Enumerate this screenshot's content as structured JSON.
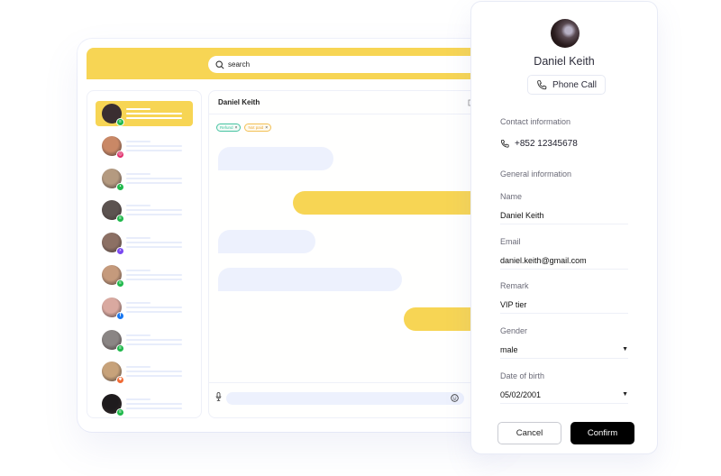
{
  "search": {
    "placeholder": "search",
    "icon": "search-icon"
  },
  "contacts": [
    {
      "avatar_color": "#3a2e31",
      "channel": "line",
      "badge_color": "#20b94c",
      "active": true
    },
    {
      "avatar_color": "#c98866",
      "channel": "instagram",
      "badge_color": "#e1306c",
      "active": false
    },
    {
      "avatar_color": "#b49a80",
      "channel": "wechat",
      "badge_color": "#20b94c",
      "active": false
    },
    {
      "avatar_color": "#5c5350",
      "channel": "line",
      "badge_color": "#20b94c",
      "active": false
    },
    {
      "avatar_color": "#8c7064",
      "channel": "messenger",
      "badge_color": "#7a48f0",
      "active": false
    },
    {
      "avatar_color": "#c59a7c",
      "channel": "line",
      "badge_color": "#20b94c",
      "active": false
    },
    {
      "avatar_color": "#d9a9a0",
      "channel": "facebook",
      "badge_color": "#1877f2",
      "active": false
    },
    {
      "avatar_color": "#8a8584",
      "channel": "line",
      "badge_color": "#20b94c",
      "active": false
    },
    {
      "avatar_color": "#c7a27a",
      "channel": "other",
      "badge_color": "#f06a35",
      "active": false
    },
    {
      "avatar_color": "#1e1b1d",
      "channel": "line",
      "badge_color": "#20b94c",
      "active": false
    }
  ],
  "chat": {
    "title": "Daniel Keith",
    "tags": [
      {
        "label": "Refund",
        "color": "green"
      },
      {
        "label": "Not paid",
        "color": "orange"
      }
    ],
    "remove_tag_glyph": "×"
  },
  "profile": {
    "name": "Daniel Keith",
    "phone_call_label": "Phone Call",
    "contact_section": "Contact information",
    "phone": "+852 12345678",
    "general_section": "General information",
    "fields": {
      "name": {
        "label": "Name",
        "value": "Daniel Keith"
      },
      "email": {
        "label": "Email",
        "value": "daniel.keith@gmail.com"
      },
      "remark": {
        "label": "Remark",
        "value": "VIP tier"
      },
      "gender": {
        "label": "Gender",
        "value": "male"
      },
      "dob": {
        "label": "Date of birth",
        "value": "05/02/2001"
      }
    },
    "dropdown_glyph": "▼",
    "cancel_label": "Cancel",
    "confirm_label": "Confirm"
  },
  "colors": {
    "accent": "#f7d554",
    "incoming_bubble": "#edf1fd",
    "confirm": "#000000"
  }
}
